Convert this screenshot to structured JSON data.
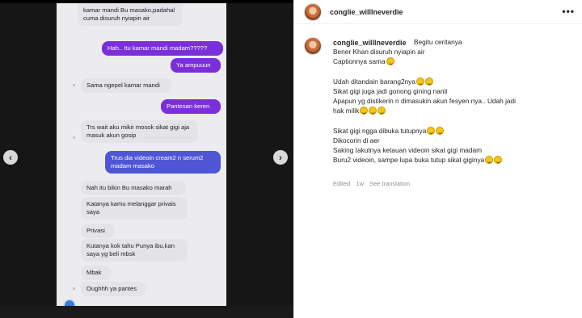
{
  "post": {
    "username": "conglie_willlneverdie",
    "more_icon": "more-options-icon",
    "caption_lines": [
      {
        "text": "Begitu ceritanya",
        "emoji": 0
      },
      {
        "text": "Bener Khan disuruh nyiapin air",
        "emoji": 0
      },
      {
        "text": "Captionnya sama",
        "emoji": 1
      },
      {
        "text": "",
        "emoji": 0
      },
      {
        "text": "Udah ditandain barang2nya",
        "emoji": 2
      },
      {
        "text": "Sikat gigi juga jadi gonong gining nanti",
        "emoji": 0
      },
      {
        "text": "Apapun yg distikerin n dimasukin akun fesyen nya.. Udah jadi",
        "emoji": 0
      },
      {
        "text": "hak milik",
        "emoji": 3
      },
      {
        "text": "",
        "emoji": 0
      },
      {
        "text": "Sikat gigi ngga dibuka tutupnya",
        "emoji": 2
      },
      {
        "text": "Dikocorin di aer",
        "emoji": 0
      },
      {
        "text": "Saking takutnya ketauan videoin sikat gigi madam",
        "emoji": 0
      },
      {
        "text": "Buru2 videoin, sampe lupa buka tutup sikat giginya",
        "emoji": 2
      }
    ],
    "edited": "Edited",
    "age": "1w",
    "see_translation": "See translation"
  },
  "media": {
    "prev_arrow": "‹",
    "next_arrow": "›",
    "messages": [
      {
        "dir": "in",
        "text": "kamar mandi Bu masako,padahal cuma disuruh nyiapin air"
      },
      {
        "dir": "out",
        "text": "Hah.. Itu kamar mandi madam?????"
      },
      {
        "dir": "out",
        "text": "Ya ampuuun"
      },
      {
        "dir": "in",
        "text": "Sama ngepel kamar mandi"
      },
      {
        "dir": "out",
        "text": "Pantesan  keren"
      },
      {
        "dir": "in",
        "text": "Trs wait aku mikir mosok sikat gigi aja masuk akun gosip"
      },
      {
        "dir": "out",
        "text": "Trus dia videoin cream2 n serum2 madam masako"
      },
      {
        "dir": "in",
        "text": "Nah itu bikin Bu masako marah"
      },
      {
        "dir": "in",
        "text": "Katanya kamu melanggar privais saya"
      },
      {
        "dir": "in",
        "text": "Privasi"
      },
      {
        "dir": "in",
        "text": "Kutanya kok tahu Punya ibu,kan saya yg beli mbsk"
      },
      {
        "dir": "in",
        "text": "Mbak"
      },
      {
        "dir": "in",
        "text": "Oughhh ya pantes"
      }
    ]
  },
  "colors": {
    "sent_bubble": "#7b2fd8",
    "sent_bubble_alt": "#4f56d6",
    "received_bubble": "#e4e4e8"
  }
}
